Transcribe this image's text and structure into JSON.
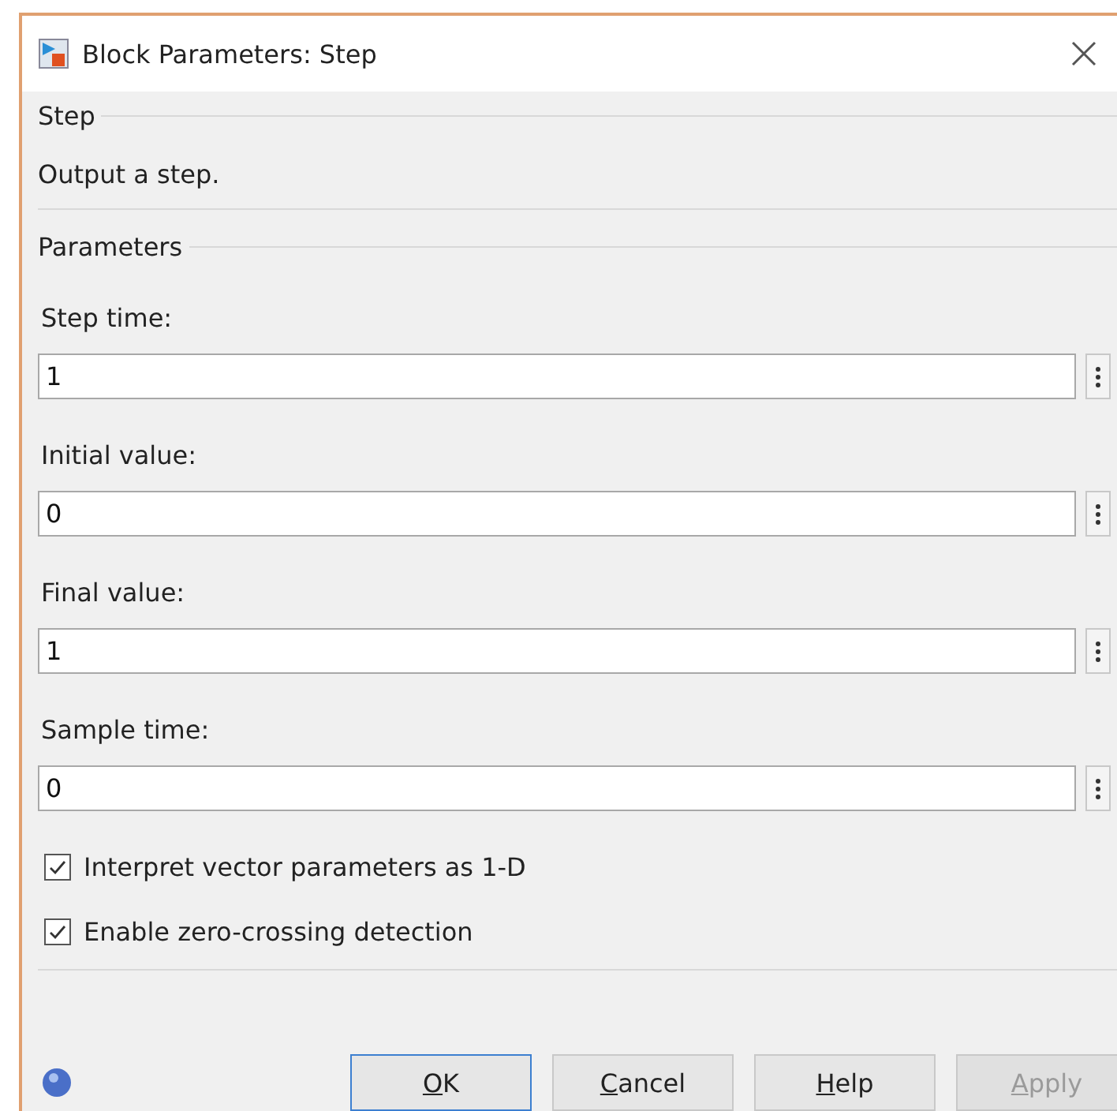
{
  "window": {
    "title": "Block Parameters: Step"
  },
  "block": {
    "name": "Step",
    "description": "Output a step."
  },
  "parameters": {
    "title": "Parameters",
    "fields": [
      {
        "label": "Step time:",
        "value": "1"
      },
      {
        "label": "Initial value:",
        "value": "0"
      },
      {
        "label": "Final value:",
        "value": "1"
      },
      {
        "label": "Sample time:",
        "value": "0"
      }
    ]
  },
  "options": [
    {
      "label": "Interpret vector parameters as 1-D",
      "checked": true
    },
    {
      "label": "Enable zero-crossing detection",
      "checked": true
    }
  ],
  "buttons": [
    {
      "label": "OK",
      "default": true,
      "disabled": false
    },
    {
      "label": "Cancel",
      "default": false,
      "disabled": false
    },
    {
      "label": "Help",
      "default": false,
      "disabled": false
    },
    {
      "label": "Apply",
      "default": false,
      "disabled": true
    }
  ]
}
